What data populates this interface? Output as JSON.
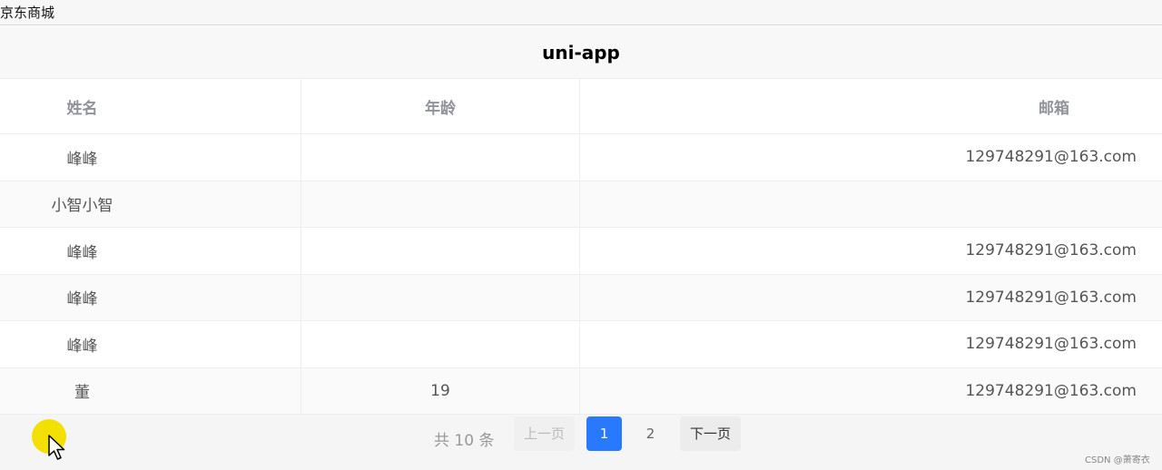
{
  "window": {
    "tab_title": "京东商城"
  },
  "navbar": {
    "title": "uni-app"
  },
  "table": {
    "columns": [
      "姓名",
      "年龄",
      "邮箱"
    ],
    "rows": [
      {
        "name": "峰峰",
        "age": "",
        "email": "129748291@163.com"
      },
      {
        "name": "小智小智",
        "age": "",
        "email": ""
      },
      {
        "name": "峰峰",
        "age": "",
        "email": "129748291@163.com"
      },
      {
        "name": "峰峰",
        "age": "",
        "email": "129748291@163.com"
      },
      {
        "name": "峰峰",
        "age": "",
        "email": "129748291@163.com"
      },
      {
        "name": "董",
        "age": "19",
        "email": "129748291@163.com"
      }
    ]
  },
  "pagination": {
    "total_label": "共 10 条",
    "prev_label": "上一页",
    "pages": [
      "1",
      "2"
    ],
    "current_page": "1",
    "next_label": "下一页"
  },
  "footer": {
    "credit": "CSDN @萧寄衣"
  },
  "colors": {
    "accent": "#2979ff",
    "cursor_highlight": "#f3e000"
  },
  "icons": {
    "cursor": "mouse-pointer-icon"
  }
}
